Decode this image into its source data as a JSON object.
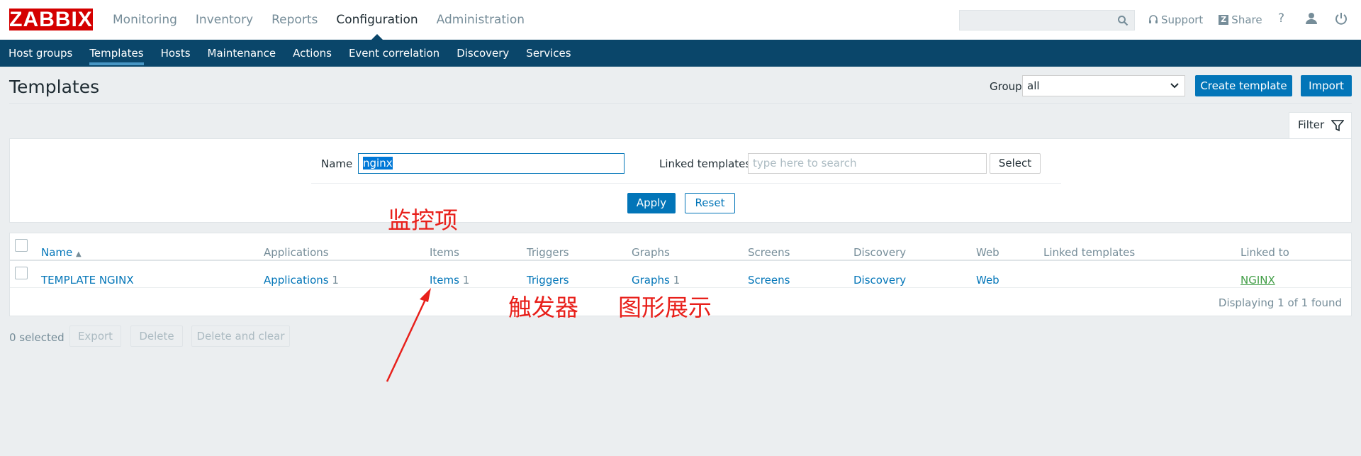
{
  "header": {
    "logo": "ZABBIX",
    "main_nav": [
      "Monitoring",
      "Inventory",
      "Reports",
      "Configuration",
      "Administration"
    ],
    "active_main": "Configuration",
    "search_value": "",
    "support_label": "Support",
    "share_label": "Share",
    "help_label": "?"
  },
  "subnav": {
    "items": [
      "Host groups",
      "Templates",
      "Hosts",
      "Maintenance",
      "Actions",
      "Event correlation",
      "Discovery",
      "Services"
    ],
    "active": "Templates"
  },
  "page": {
    "title": "Templates",
    "group_label": "Group",
    "group_value": "all",
    "create_button": "Create template",
    "import_button": "Import"
  },
  "filter": {
    "tab_label": "Filter",
    "name_label": "Name",
    "name_value": "nginx",
    "linked_label": "Linked templates",
    "linked_placeholder": "type here to search",
    "select_button": "Select",
    "apply_button": "Apply",
    "reset_button": "Reset"
  },
  "table": {
    "columns": [
      "Name",
      "Applications",
      "Items",
      "Triggers",
      "Graphs",
      "Screens",
      "Discovery",
      "Web",
      "Linked templates",
      "Linked to"
    ],
    "sort_indicator": "▲",
    "rows": [
      {
        "name": "TEMPLATE NGINX",
        "applications": "Applications",
        "applications_count": "1",
        "items": "Items",
        "items_count": "1",
        "triggers": "Triggers",
        "graphs": "Graphs",
        "graphs_count": "1",
        "screens": "Screens",
        "discovery": "Discovery",
        "web": "Web",
        "linked_templates": "",
        "linked_to": "NGINX"
      }
    ],
    "footer": "Displaying 1 of 1 found"
  },
  "actions": {
    "selected": "0 selected",
    "export": "Export",
    "delete": "Delete",
    "delete_clear": "Delete and clear"
  },
  "annotations": {
    "items_note": "监控项",
    "triggers_note": "触发器",
    "graphs_note": "图形展示",
    "color": "#e8201b"
  },
  "colors": {
    "brand": "#d40000",
    "subnav": "#0a466a",
    "primary": "#0275b8",
    "link_green": "#429e47"
  }
}
